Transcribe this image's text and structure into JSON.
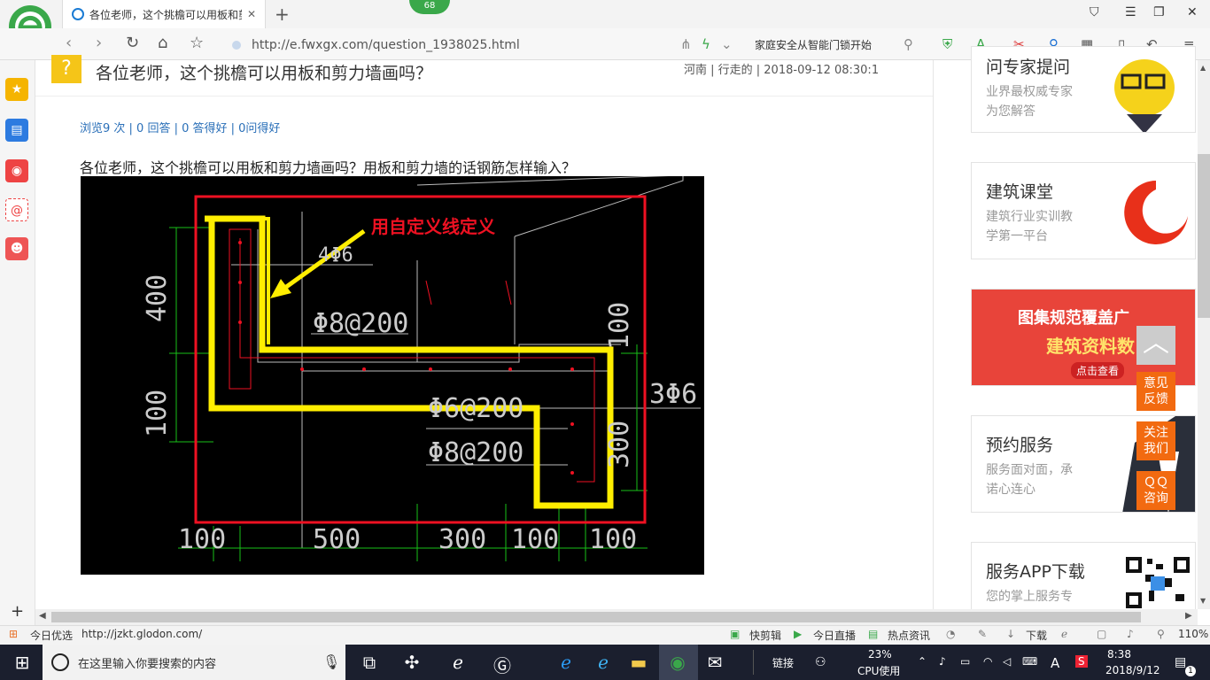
{
  "browser": {
    "tab_title": "各位老师，这个挑檐可以用板和剪",
    "badge": "68",
    "url": "http://e.fwxgx.com/question_1938025.html",
    "ad_text": "家庭安全从智能门锁开始"
  },
  "question": {
    "title": "各位老师，这个挑檐可以用板和剪力墙画吗？",
    "meta": "河南 | 行走的 | 2018-09-12 08:30:1",
    "stats": "浏览9 次 | 0 回答 | 0 答得好 | 0问得好",
    "body": "各位老师，这个挑檐可以用板和剪力墙画吗？用板和剪力墙的话钢筋怎样输入？"
  },
  "cad": {
    "annotation": "用自定义线定义",
    "rebar_top": "4Φ6",
    "rebar_mid": "Φ8@200",
    "rebar_low": "Φ6@200",
    "rebar_low2": "Φ8@200",
    "rebar_right": "3Φ6",
    "dim_400": "400",
    "dim_100_left": "100",
    "dim_300_right": "300",
    "dim_100_right_top": "100",
    "bottom_dims": [
      "100",
      "500",
      "300",
      "100",
      "100"
    ]
  },
  "right_ads": [
    {
      "title": "问专家提问",
      "sub": [
        "业界最权威专家",
        "为您解答"
      ]
    },
    {
      "title": "建筑课堂",
      "sub": [
        "建筑行业实训教",
        "学第一平台"
      ]
    },
    {
      "title": "图集规范覆盖广",
      "sub2": "建筑资料数",
      "btn": "点击查看"
    },
    {
      "title": "预约服务",
      "sub": [
        "服务面对面，承",
        "诺心连心"
      ]
    },
    {
      "title": "服务APP下载",
      "sub": [
        "您的掌上服务专"
      ]
    }
  ],
  "float_buttons": [
    "意见\n反馈",
    "关注\n我们",
    "ＱＱ\n咨询"
  ],
  "status": {
    "left_label": "今日优选",
    "link": "http://jzkt.glodon.com/",
    "items": [
      "快剪辑",
      "今日直播",
      "热点资讯",
      "下载"
    ],
    "zoom": "110%"
  },
  "taskbar": {
    "search_placeholder": "在这里输入你要搜索的内容",
    "link_label": "链接",
    "cpu_pct": "23%",
    "cpu_label": "CPU使用",
    "ime": "A",
    "time": "8:38",
    "date": "2018/9/12",
    "notif": "1"
  }
}
